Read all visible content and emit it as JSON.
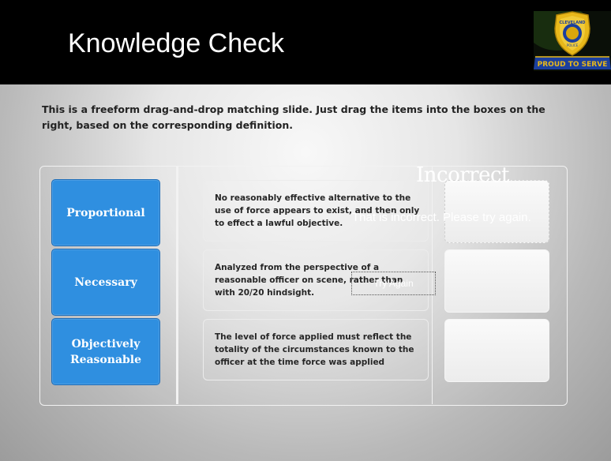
{
  "header": {
    "title": "Knowledge Check",
    "badge": {
      "icon": "police-badge-icon",
      "top_text": "CLEVELAND",
      "bottom_text": "POLICE",
      "banner": "PROUD TO SERVE",
      "colors": {
        "gold": "#e8b81a",
        "blue": "#1b3f9e",
        "green": "#2a5a1e"
      }
    }
  },
  "instructions": "This is a freeform drag-and-drop matching slide. Just drag the items into the boxes on the right, based on the corresponding definition.",
  "terms": [
    {
      "label": "Proportional"
    },
    {
      "label": "Necessary"
    },
    {
      "label": "Objectively Reasonable"
    }
  ],
  "definitions": [
    {
      "text": "No reasonably effective alternative to the use of force appears to exist, and then only to effect a lawful objective."
    },
    {
      "text": "Analyzed from the perspective of a reasonable officer on scene, rather than with 20/20 hindsight."
    },
    {
      "text": "The level of force applied must reflect the totality of the circumstances known to the officer at the time force was applied"
    }
  ],
  "feedback": {
    "title": "Incorrect",
    "message": "That is incorrect. Please try again.",
    "button_label": "Try Again"
  },
  "colors": {
    "term_box": "#2f8fe0",
    "header_bg": "#000000"
  }
}
